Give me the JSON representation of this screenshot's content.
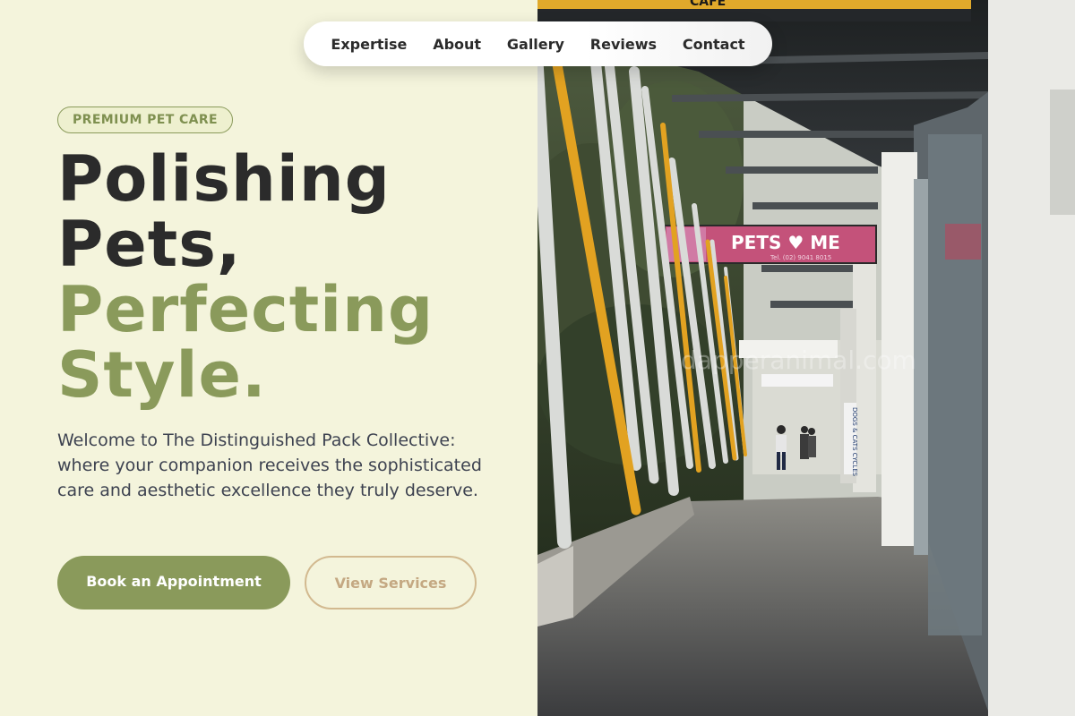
{
  "nav": {
    "items": [
      {
        "label": "Expertise"
      },
      {
        "label": "About"
      },
      {
        "label": "Gallery"
      },
      {
        "label": "Reviews"
      },
      {
        "label": "Contact"
      }
    ]
  },
  "hero": {
    "badge": "PREMIUM PET CARE",
    "headline_line1": "Polishing",
    "headline_line2": "Pets,",
    "headline_line3": "Perfecting",
    "headline_line4": "Style.",
    "lead": "Welcome to The Distinguished Pack Collective: where your companion receives the sophisticated care and aesthetic excellence they truly deserve.",
    "primary_button": "Book an Appointment",
    "secondary_button": "View Services"
  },
  "photo": {
    "sign_top": "CAFE",
    "shop_sign": "PETS ♥ ME",
    "shop_phone": "Tel. (02) 9041 8015",
    "side_sign": "DOGS & CATS CYCLES",
    "watermark": "dapperanimal.com"
  },
  "colors": {
    "accent_green": "#8a9a5b",
    "background_cream": "#f4f4dc",
    "text_dark": "#2b2b2b",
    "secondary_tan": "#c4a882"
  }
}
